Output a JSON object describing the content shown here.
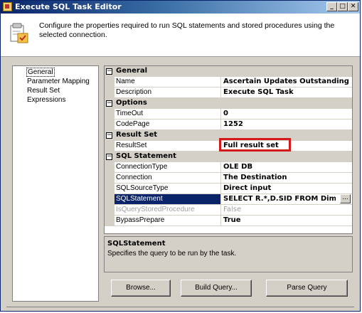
{
  "window": {
    "title": "Execute SQL Task Editor"
  },
  "header": {
    "description": "Configure the properties required to run SQL statements and stored procedures using the selected connection."
  },
  "nav": {
    "items": [
      {
        "label": "General",
        "selected": true
      },
      {
        "label": "Parameter Mapping"
      },
      {
        "label": "Result Set"
      },
      {
        "label": "Expressions"
      }
    ]
  },
  "grid": {
    "categories": {
      "general": "General",
      "options": "Options",
      "result_set": "Result Set",
      "sql_statement": "SQL Statement"
    },
    "props": {
      "name": {
        "label": "Name",
        "value": "Ascertain Updates Outstanding"
      },
      "description": {
        "label": "Description",
        "value": "Execute SQL Task"
      },
      "timeout": {
        "label": "TimeOut",
        "value": "0"
      },
      "codepage": {
        "label": "CodePage",
        "value": "1252"
      },
      "resultset": {
        "label": "ResultSet",
        "value": "Full result set"
      },
      "connectiontype": {
        "label": "ConnectionType",
        "value": "OLE DB"
      },
      "connection": {
        "label": "Connection",
        "value": "The Destination"
      },
      "sqlsourcetype": {
        "label": "SQLSourceType",
        "value": "Direct input"
      },
      "sqlstatement": {
        "label": "SQLStatement",
        "value": "SELECT R.*,D.SID FROM DimComp"
      },
      "isquerystored": {
        "label": "IsQueryStoredProcedure",
        "value": "False"
      },
      "bypassprepare": {
        "label": "BypassPrepare",
        "value": "True"
      }
    },
    "ellipsis": "..."
  },
  "description_panel": {
    "title": "SQLStatement",
    "text": "Specifies the query to be run by the task."
  },
  "buttons": {
    "browse": "Browse...",
    "build_query": "Build Query...",
    "parse_query": "Parse Query"
  },
  "titlebar_buttons": {
    "minimize": "_",
    "maximize": "□",
    "close": "✕"
  },
  "colors": {
    "titlebar": "#0a246a",
    "selection": "#0a246a",
    "highlight_box": "#d41b1b"
  },
  "icons": [
    "app-icon",
    "task-config-icon",
    "collapse-icon"
  ]
}
